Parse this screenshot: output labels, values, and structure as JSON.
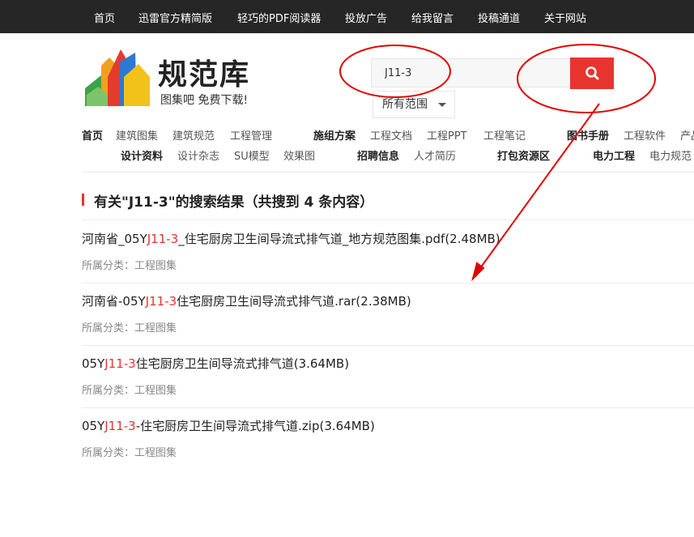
{
  "topnav": [
    "首页",
    "迅雷官方精简版",
    "轻巧的PDF阅读器",
    "投放广告",
    "给我留言",
    "投稿通道",
    "关于网站"
  ],
  "logo": {
    "title": "规范库",
    "slogan": "图集吧 免费下载!"
  },
  "search": {
    "value": "J11-3",
    "scope": "所有范围"
  },
  "nav_row1": [
    "首页",
    "建筑图集",
    "建筑规范",
    "工程管理",
    "施组方案",
    "工程文档",
    "工程PPT",
    "工程笔记",
    "图书手册",
    "工程软件",
    "产品"
  ],
  "nav_row2": [
    "设计资料",
    "设计杂志",
    "SU模型",
    "效果图",
    "招聘信息",
    "人才简历",
    "打包资源区",
    "电力工程",
    "电力规范"
  ],
  "results": {
    "heading": "有关\"J11-3\"的搜索结果（共搜到 4 条内容）",
    "items": [
      {
        "pre": "河南省_05Y",
        "hl": "J11-3",
        "post": "_住宅厨房卫生间导流式排气道_地方规范图集.pdf(2.48MB)",
        "category": "所属分类：工程图集"
      },
      {
        "pre": "河南省-05Y",
        "hl": "J11-3",
        "post": "住宅厨房卫生间导流式排气道.rar(2.38MB)",
        "category": "所属分类：工程图集"
      },
      {
        "pre": "05Y",
        "hl": "J11-3",
        "post": "住宅厨房卫生间导流式排气道(3.64MB)",
        "category": "所属分类：工程图集"
      },
      {
        "pre": "05Y",
        "hl": "J11-3",
        "post": "-住宅厨房卫生间导流式排气道.zip(3.64MB)",
        "category": "所属分类：工程图集"
      }
    ]
  },
  "colors": {
    "accent": "#e8342e",
    "topbar": "#262626",
    "annotation": "#e00000"
  }
}
